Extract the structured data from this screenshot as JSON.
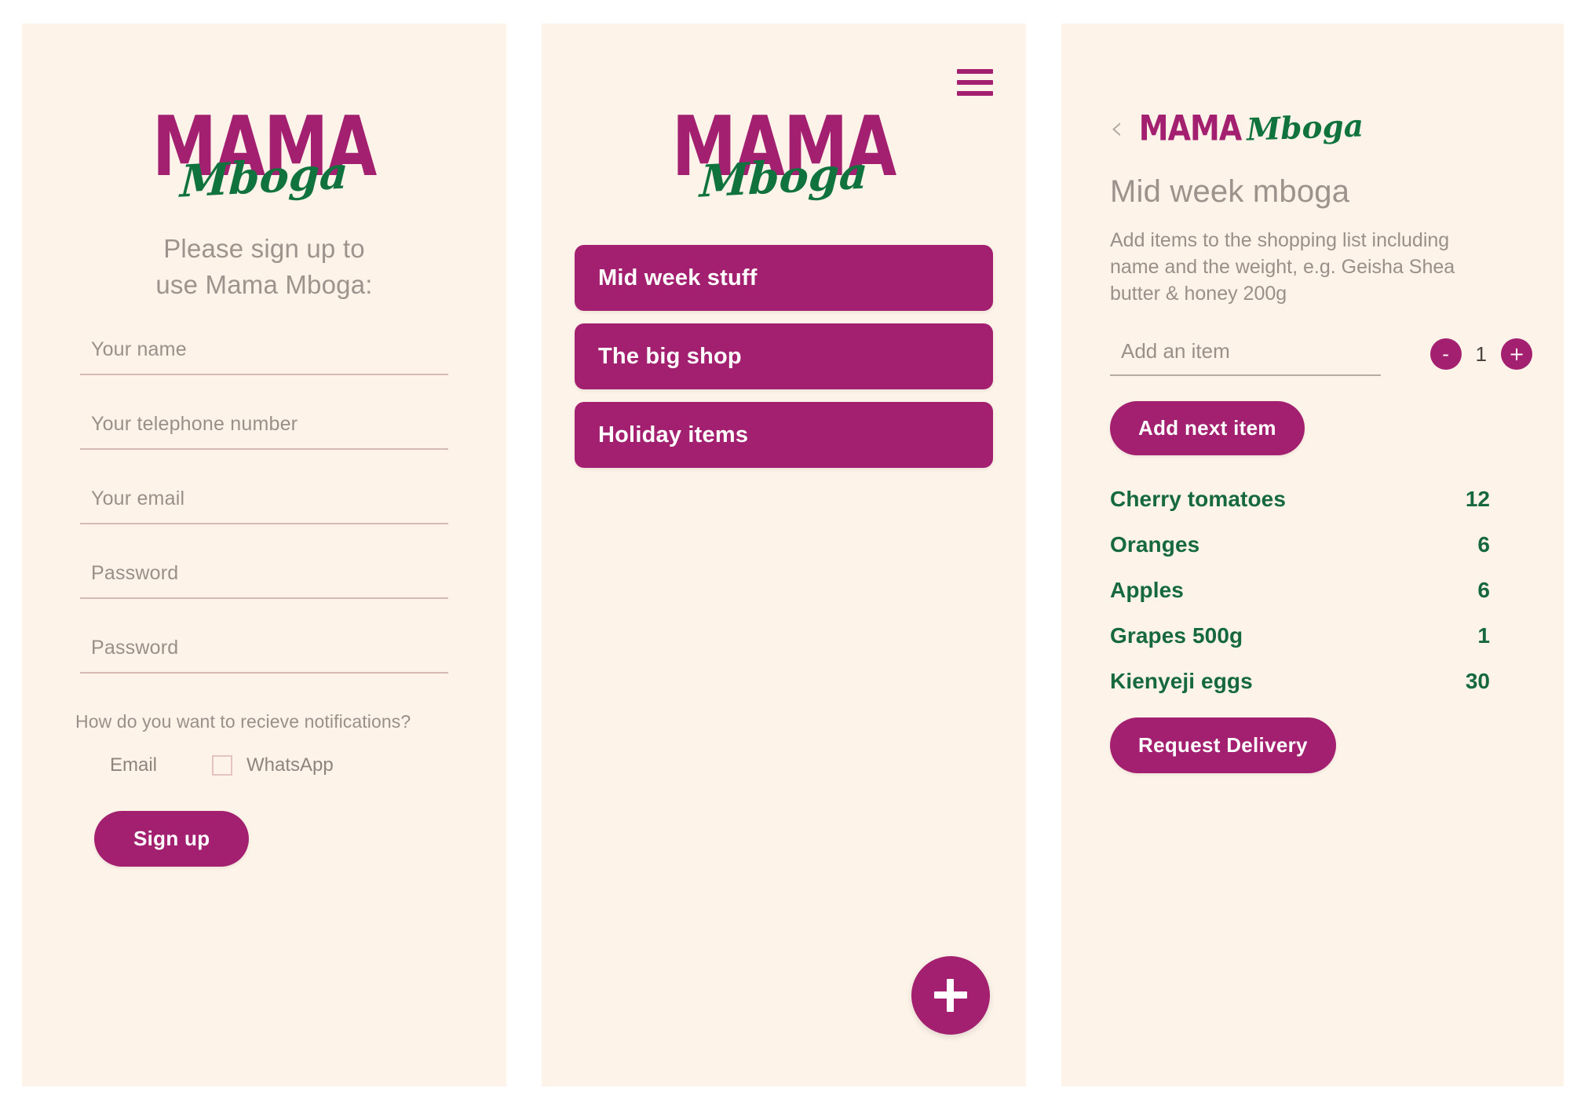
{
  "brand": {
    "name_top": "MAMA",
    "name_bottom": "Mboga",
    "primary_color": "#a32070",
    "secondary_color": "#10733e",
    "background_color": "#fdf3e9",
    "muted_text_color": "#9b9089"
  },
  "screen_signup": {
    "heading_line1": "Please sign up to",
    "heading_line2": "use Mama Mboga:",
    "fields": [
      {
        "name": "name",
        "placeholder": "Your name",
        "value": ""
      },
      {
        "name": "telephone",
        "placeholder": "Your telephone number",
        "value": ""
      },
      {
        "name": "email",
        "placeholder": "Your email",
        "value": ""
      },
      {
        "name": "password",
        "placeholder": "Password",
        "value": ""
      },
      {
        "name": "password_confirm",
        "placeholder": "Password",
        "value": ""
      }
    ],
    "notifications_question": "How do you want to recieve notifications?",
    "notification_options": [
      {
        "label": "Email",
        "checked": false,
        "box_visible": false
      },
      {
        "label": "WhatsApp",
        "checked": false,
        "box_visible": true
      }
    ],
    "submit_label": "Sign up"
  },
  "screen_lists": {
    "menu_icon": "hamburger-icon",
    "lists": [
      {
        "label": "Mid week stuff"
      },
      {
        "label": "The big shop"
      },
      {
        "label": "Holiday items"
      }
    ],
    "fab_icon": "plus-icon",
    "fab_label": "+"
  },
  "screen_detail": {
    "back_icon": "chevron-left-icon",
    "title": "Mid week mboga",
    "description": "Add items to the shopping list including name and the weight, e.g. Geisha Shea butter & honey 200g",
    "add_item_placeholder": "Add an item",
    "add_item_value": "",
    "stepper": {
      "decrement_label": "-",
      "value": "1",
      "increment_label": "+"
    },
    "add_next_label": "Add next item",
    "items": [
      {
        "name": "Cherry tomatoes",
        "qty": "12"
      },
      {
        "name": "Oranges",
        "qty": "6"
      },
      {
        "name": "Apples",
        "qty": "6"
      },
      {
        "name": "Grapes 500g",
        "qty": "1"
      },
      {
        "name": "Kienyeji eggs",
        "qty": "30"
      }
    ],
    "request_delivery_label": "Request Delivery"
  }
}
